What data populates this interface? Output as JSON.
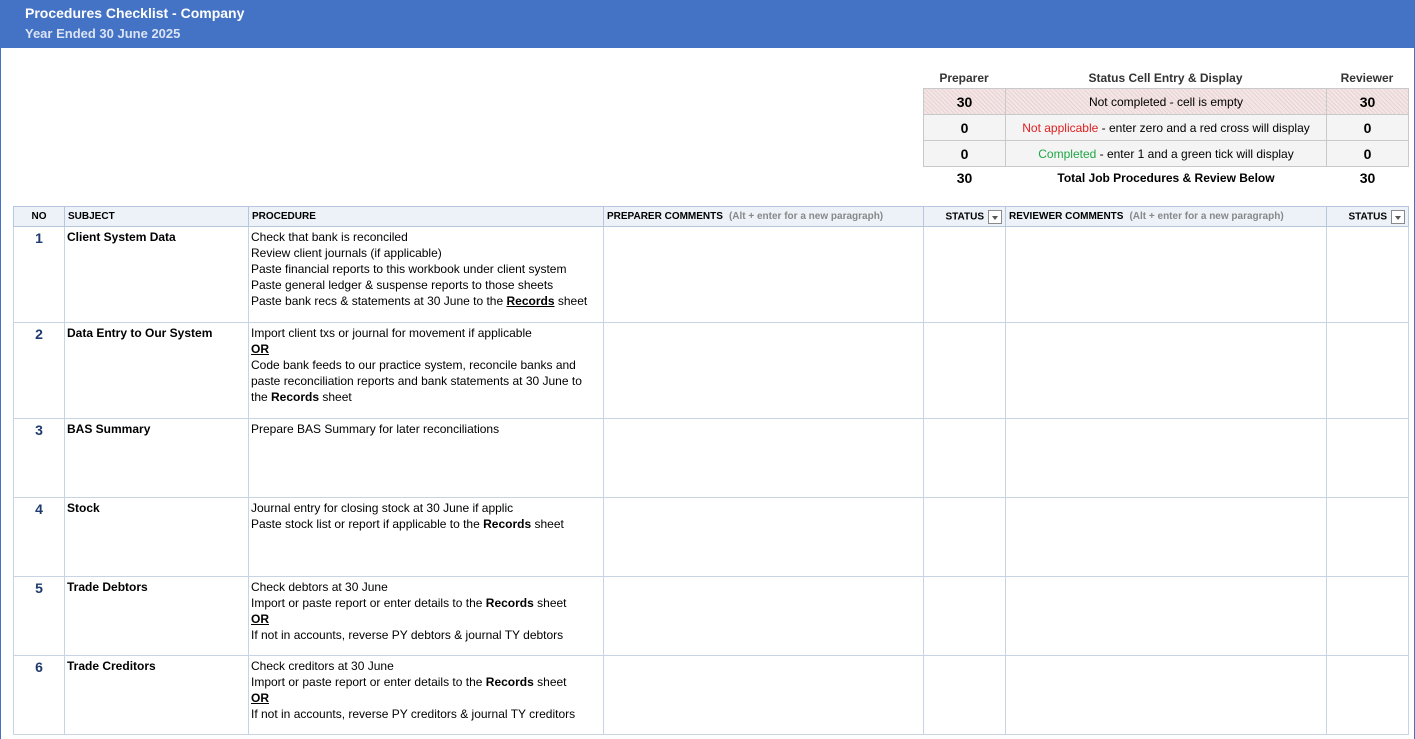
{
  "header": {
    "title": "Procedures Checklist - Company",
    "subtitle": "Year Ended 30 June 2025"
  },
  "summary": {
    "preparer_heading": "Preparer",
    "status_heading": "Status Cell Entry & Display",
    "reviewer_heading": "Reviewer",
    "rows": [
      {
        "preparer": "30",
        "status_prefix": "",
        "status_text": "Not completed - cell is empty",
        "reviewer": "30"
      },
      {
        "preparer": "0",
        "status_prefix": "Not applicable",
        "status_text": " - enter zero and a red cross will display",
        "reviewer": "0"
      },
      {
        "preparer": "0",
        "status_prefix": "Completed",
        "status_text": " - enter 1 and a green tick will display",
        "reviewer": "0"
      }
    ],
    "total": {
      "preparer": "30",
      "label": "Total Job Procedures & Review Below",
      "reviewer": "30"
    }
  },
  "columns": {
    "no": "NO",
    "subject": "SUBJECT",
    "procedure": "PROCEDURE",
    "preparer_comments": "PREPARER COMMENTS",
    "preparer_hint": "(Alt + enter for a new paragraph)",
    "status": "STATUS",
    "reviewer_comments": "REVIEWER COMMENTS",
    "reviewer_hint": "(Alt + enter for a new paragraph)",
    "status2": "STATUS"
  },
  "rows": [
    {
      "no": "1",
      "subject": "Client System Data",
      "lines": [
        "Check that bank is reconciled",
        "Review client journals (if applicable)",
        "Paste financial reports to this workbook under client system",
        "Paste general ledger & suspense reports to those sheets"
      ],
      "last_pre": "Paste bank recs & statements at 30 June to the ",
      "last_bold": "Records",
      "last_post": " sheet"
    },
    {
      "no": "2",
      "subject": "Data Entry to Our System",
      "l1": "Import client txs or journal for movement if applicable",
      "or": "OR",
      "l2": "Code bank feeds to our practice system, reconcile banks and",
      "l3": "paste reconciliation reports and bank statements at 30 June to",
      "l4_pre": "the ",
      "l4_bold": "Records",
      "l4_post": " sheet"
    },
    {
      "no": "3",
      "subject": "BAS Summary",
      "l1": "Prepare BAS Summary for later reconciliations"
    },
    {
      "no": "4",
      "subject": "Stock",
      "l1": "Journal entry for closing stock at 30 June if applic",
      "l2_pre": "Paste stock list or report if applicable to the ",
      "l2_bold": "Records",
      "l2_post": " sheet"
    },
    {
      "no": "5",
      "subject": "Trade Debtors",
      "l1": "Check debtors at 30 June",
      "l2_pre": "Import or paste report or enter details to the ",
      "l2_bold": "Records",
      "l2_post": " sheet",
      "or": "OR",
      "l3": "If not in accounts, reverse PY debtors & journal TY debtors"
    },
    {
      "no": "6",
      "subject": "Trade Creditors",
      "l1": "Check creditors at 30 June",
      "l2_pre": "Import or paste report or enter details to the ",
      "l2_bold": "Records",
      "l2_post": " sheet",
      "or": "OR",
      "l3": "If not in accounts, reverse PY creditors & journal TY creditors"
    }
  ]
}
